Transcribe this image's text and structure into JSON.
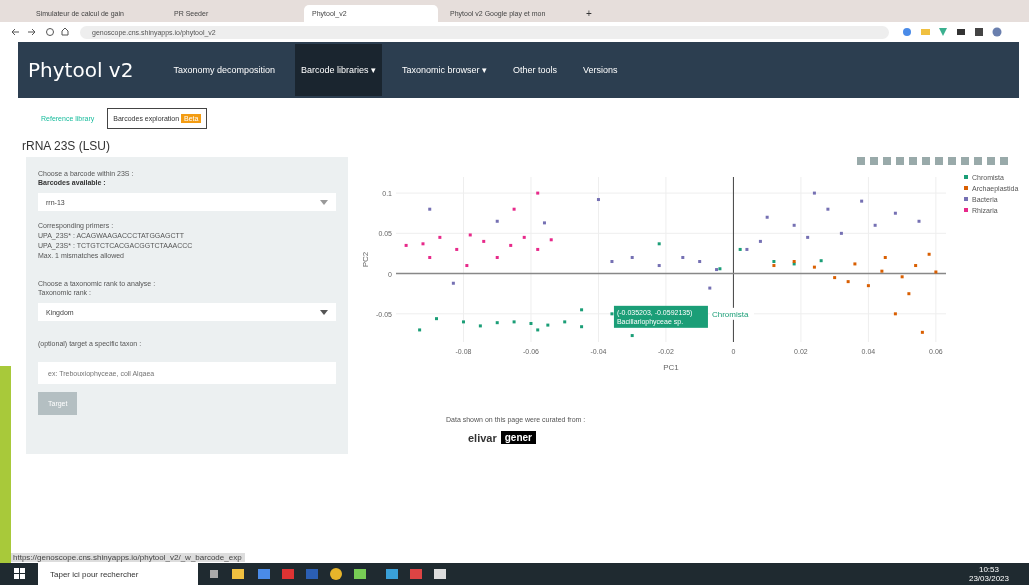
{
  "browser": {
    "tabs": [
      {
        "label": "Simulateur de calcul de gain",
        "selected": false
      },
      {
        "label": "PR Seeder",
        "selected": false
      },
      {
        "label": "Phytool_v2",
        "selected": true
      },
      {
        "label": "Phytool v2 Google play et mon",
        "selected": false
      }
    ],
    "new_tab": "+",
    "url": "genoscope.cns.shinyapps.io/phytool_v2",
    "status_link": "https://genoscope.cns.shinyapps.io/phytool_v2/_w_barcode_exp"
  },
  "navbar": {
    "brand": "Phytool v2",
    "items": [
      {
        "label": "Taxonomy decomposition",
        "selected": false
      },
      {
        "label": "Barcode libraries ▾",
        "selected": true
      },
      {
        "label": "Taxonomic browser ▾",
        "selected": false
      },
      {
        "label": "Other tools",
        "selected": false
      },
      {
        "label": "Versions",
        "selected": false
      }
    ]
  },
  "subtabs": [
    {
      "label": "Reference library",
      "selected": false
    },
    {
      "label": "Barcodes exploration",
      "badge": "Beta",
      "selected": true
    }
  ],
  "heading": "rRNA 23S (LSU)",
  "panel": {
    "barcode_label": "Choose a barcode within 23S :",
    "available_label": "Barcodes available :",
    "barcode_value": "rrn-13",
    "primers": [
      "Corresponding primers :",
      "UPA_23S* : ACAGWAAGACCCTATGGAGCTT",
      "UPA_23S* : TCTGTCTCACGACGGTCTAAACCC",
      "Max. 1 mismatches allowed"
    ],
    "rank_label": "Choose a taxonomic rank to analyse :",
    "rank_sub": "Taxonomic rank :",
    "rank_value": "Kingdom",
    "taxon_label": "(optional) target a specific taxon :",
    "taxon_placeholder": "ex: Trebouxiophyceae, coll Algaea",
    "target_button": "Target",
    "target_disabled": true
  },
  "chart": {
    "chart_data": {
      "type": "scatter",
      "grid": true,
      "legend": "right",
      "xlabel": "PC1",
      "ylabel": "PC2",
      "xlim": [
        -0.1,
        0.063
      ],
      "ylim": [
        -0.085,
        0.12
      ],
      "xticks": [
        -0.08,
        -0.06,
        -0.04,
        -0.02,
        0,
        0.02,
        0.04,
        0.06
      ],
      "yticks": [
        -0.05,
        0,
        0.05,
        0.1
      ],
      "series": [
        {
          "name": "Chromista",
          "color": "#1b9e77",
          "x": [
            -0.088,
            -0.08,
            -0.075,
            -0.07,
            -0.065,
            -0.06,
            -0.055,
            -0.05,
            -0.045,
            -0.036,
            -0.03,
            -0.045,
            -0.022,
            -0.004,
            0.002,
            0.012,
            0.018,
            0.026,
            -0.093,
            -0.058
          ],
          "values": [
            -0.056,
            -0.06,
            -0.065,
            -0.061,
            -0.06,
            -0.062,
            -0.064,
            -0.06,
            -0.045,
            -0.05,
            -0.077,
            -0.066,
            0.037,
            0.006,
            0.03,
            0.015,
            0.012,
            0.016,
            -0.07,
            -0.07
          ]
        },
        {
          "name": "Archaeplastida",
          "color": "#d95f02",
          "x": [
            0.012,
            0.018,
            0.024,
            0.03,
            0.036,
            0.04,
            0.045,
            0.05,
            0.054,
            0.058,
            0.06,
            0.048,
            0.056,
            0.052,
            0.044,
            0.034
          ],
          "values": [
            0.01,
            0.015,
            0.008,
            -0.005,
            0.012,
            -0.015,
            0.02,
            -0.004,
            0.01,
            0.024,
            0.002,
            -0.05,
            -0.073,
            -0.025,
            0.003,
            -0.01
          ]
        },
        {
          "name": "Bacteria",
          "color": "#7570b3",
          "x": [
            -0.09,
            -0.07,
            -0.056,
            -0.04,
            -0.036,
            -0.03,
            -0.022,
            -0.015,
            -0.01,
            -0.005,
            0.004,
            0.01,
            0.018,
            0.022,
            0.028,
            0.032,
            0.038,
            0.042,
            0.048,
            0.055,
            0.024,
            -0.083,
            -0.007,
            0.008
          ],
          "values": [
            0.08,
            0.065,
            0.063,
            0.092,
            0.015,
            0.02,
            0.01,
            0.02,
            0.015,
            0.005,
            0.03,
            0.07,
            0.06,
            0.045,
            0.08,
            0.05,
            0.09,
            0.06,
            0.075,
            0.065,
            0.1,
            -0.012,
            -0.018,
            0.04
          ]
        },
        {
          "name": "Rhizaria",
          "color": "#e7298a",
          "x": [
            -0.097,
            -0.092,
            -0.087,
            -0.082,
            -0.078,
            -0.074,
            -0.07,
            -0.066,
            -0.062,
            -0.058,
            -0.054,
            -0.09,
            -0.065,
            -0.058,
            -0.079
          ],
          "values": [
            0.035,
            0.037,
            0.045,
            0.03,
            0.048,
            0.04,
            0.02,
            0.035,
            0.045,
            0.03,
            0.042,
            0.02,
            0.08,
            0.1,
            0.01
          ]
        }
      ]
    },
    "tooltip": [
      "(-0.035203, -0.0592135)",
      "Bacillariophyceae sp."
    ],
    "tooltip_series": "Chromista"
  },
  "footer": {
    "text": "Data shown on this page were curated from :",
    "logos": [
      "elivar",
      "gener"
    ]
  },
  "taskbar": {
    "search_placeholder": "Taper ici pour rechercher",
    "time": "10:53",
    "date": "23/03/2023"
  }
}
